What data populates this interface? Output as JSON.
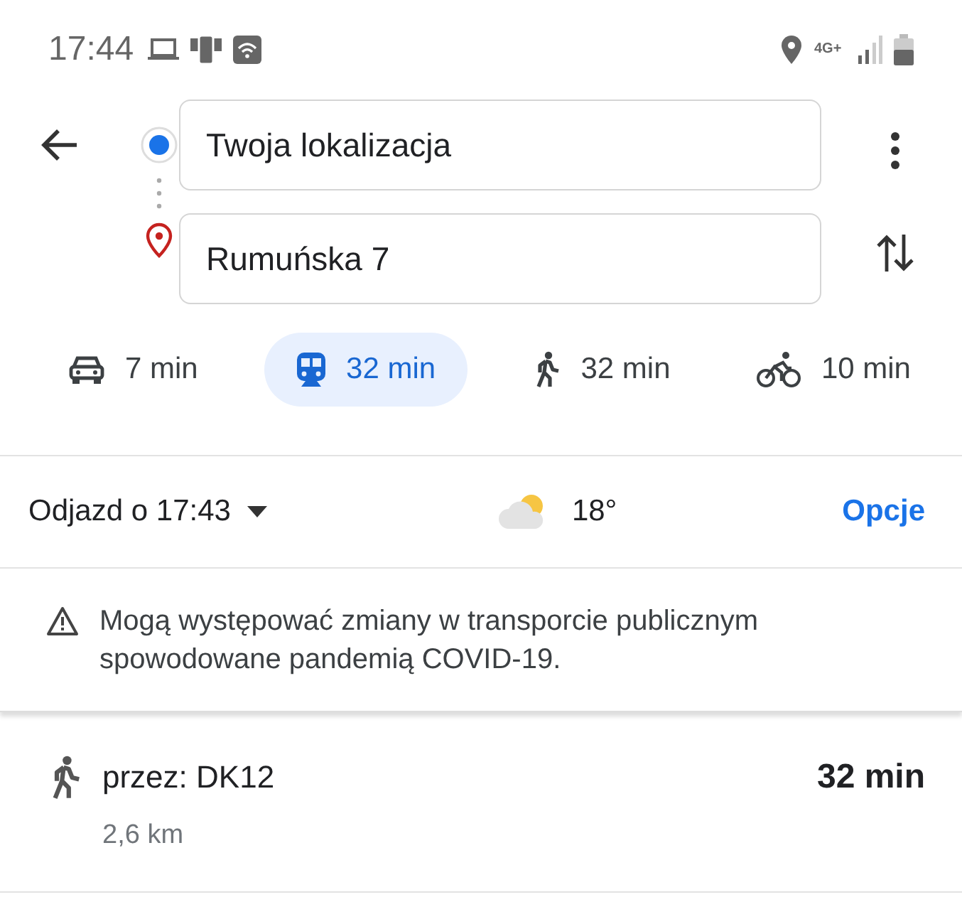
{
  "status_bar": {
    "time": "17:44",
    "network": "4G+"
  },
  "directions": {
    "origin": {
      "value": "Twoja lokalizacja"
    },
    "destination": {
      "value": "Rumuńska 7"
    }
  },
  "modes": [
    {
      "kind": "car",
      "label": "7 min",
      "selected": false
    },
    {
      "kind": "transit",
      "label": "32 min",
      "selected": true
    },
    {
      "kind": "walk",
      "label": "32 min",
      "selected": false
    },
    {
      "kind": "bike",
      "label": "10 min",
      "selected": false
    }
  ],
  "departure": {
    "label": "Odjazd o 17:43",
    "temperature": "18°",
    "options": "Opcje"
  },
  "notice": "Mogą występować zmiany w transporcie publicznym spowodowane pandemią COVID-19.",
  "route": {
    "via": "przez: DK12",
    "duration": "32 min",
    "distance": "2,6 km"
  }
}
